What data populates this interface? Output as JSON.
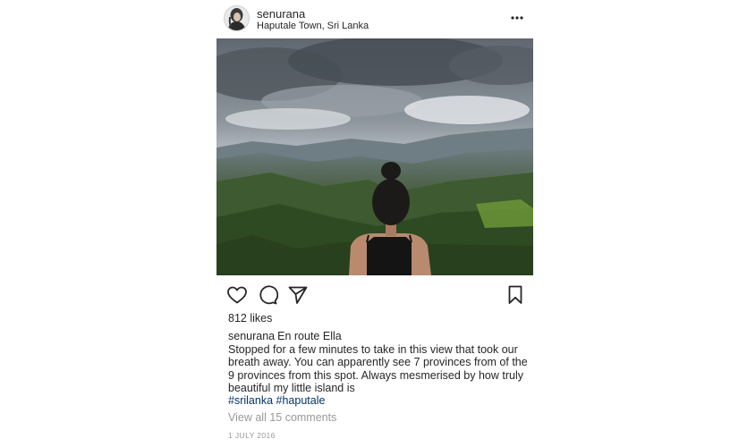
{
  "header": {
    "username": "senurana",
    "location": "Haputale Town, Sri Lanka",
    "more_icon": "more-horizontal-icon"
  },
  "photo": {
    "subject": "woman looking over mountain valley under cloudy sky"
  },
  "actions": {
    "like_icon": "heart-icon",
    "comment_icon": "comment-icon",
    "share_icon": "send-icon",
    "save_icon": "bookmark-icon"
  },
  "likes": "812 likes",
  "caption": {
    "username": "senurana",
    "line1": "En route Ella",
    "body": "Stopped for a few minutes to take in this view that took our breath away. You can apparently see 7 provinces from of the 9 provinces from this spot. Always mesmerised by how truly beautiful my little island is"
  },
  "hashtags": [
    "#srilanka",
    "#haputale"
  ],
  "comments_link": "View all 15 comments",
  "date": "1 JULY 2016",
  "colors": {
    "text": "#262626",
    "muted": "#999999",
    "hashtag": "#003569"
  }
}
